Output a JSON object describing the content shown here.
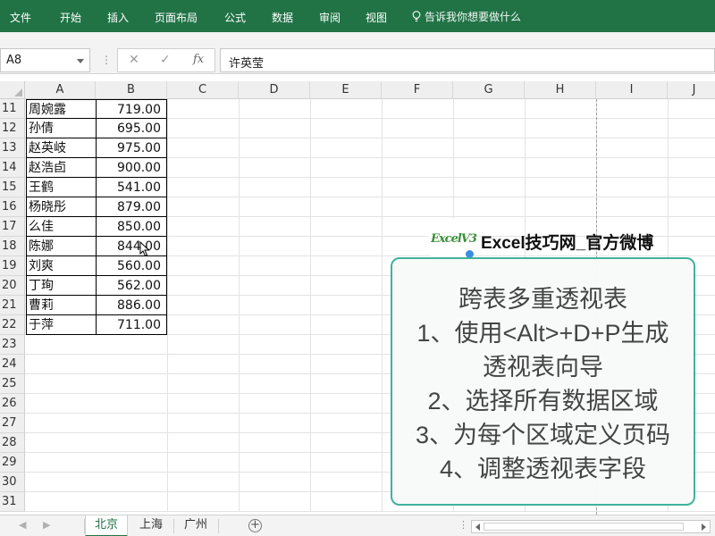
{
  "ribbon": {
    "tabs": [
      "文件",
      "开始",
      "插入",
      "页面布局",
      "公式",
      "数据",
      "审阅",
      "视图"
    ],
    "tell_me": "告诉我你想要做什么",
    "color": "#217346"
  },
  "formula_bar": {
    "name_box": "A8",
    "cancel_icon": "✕",
    "confirm_icon": "✓",
    "fx_label": "fx",
    "value": "许英莹"
  },
  "columns": [
    "A",
    "B",
    "C",
    "D",
    "E",
    "F",
    "G",
    "H",
    "I",
    "J"
  ],
  "rows": [
    {
      "num": "11",
      "a": "周婉露",
      "b": "719.00"
    },
    {
      "num": "12",
      "a": "孙倩",
      "b": "695.00"
    },
    {
      "num": "13",
      "a": "赵英岐",
      "b": "975.00"
    },
    {
      "num": "14",
      "a": "赵浩卣",
      "b": "900.00"
    },
    {
      "num": "15",
      "a": "王鹤",
      "b": "541.00"
    },
    {
      "num": "16",
      "a": "杨晓彤",
      "b": "879.00"
    },
    {
      "num": "17",
      "a": "么佳",
      "b": "850.00"
    },
    {
      "num": "18",
      "a": "陈娜",
      "b": "844.00"
    },
    {
      "num": "19",
      "a": "刘爽",
      "b": "560.00"
    },
    {
      "num": "20",
      "a": "丁珣",
      "b": "562.00"
    },
    {
      "num": "21",
      "a": "曹莉",
      "b": "886.00"
    },
    {
      "num": "22",
      "a": "于萍",
      "b": "711.00"
    },
    {
      "num": "23",
      "a": "",
      "b": ""
    },
    {
      "num": "24",
      "a": "",
      "b": ""
    },
    {
      "num": "25",
      "a": "",
      "b": ""
    },
    {
      "num": "26",
      "a": "",
      "b": ""
    },
    {
      "num": "27",
      "a": "",
      "b": ""
    },
    {
      "num": "28",
      "a": "",
      "b": ""
    },
    {
      "num": "29",
      "a": "",
      "b": ""
    },
    {
      "num": "30",
      "a": "",
      "b": ""
    },
    {
      "num": "31",
      "a": "",
      "b": ""
    }
  ],
  "overlay": {
    "account_name": "Excel技巧网_官方微博",
    "logo_text": "ExcelV3",
    "lines": [
      "跨表多重透视表",
      "1、使用<Alt>+D+P生成",
      "透视表向导",
      "2、选择所有数据区域",
      "3、为每个区域定义页码",
      "4、调整透视表字段"
    ],
    "border_color": "#3fb39a"
  },
  "sheet_tabs": {
    "tabs": [
      "北京",
      "上海",
      "广州"
    ],
    "active": "北京",
    "add_icon": "+"
  }
}
